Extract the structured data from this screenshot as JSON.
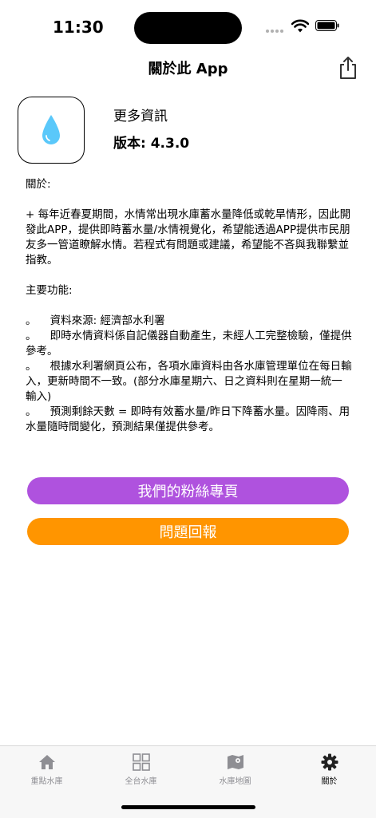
{
  "status": {
    "time": "11:30"
  },
  "nav": {
    "title": "關於此 App",
    "share_icon": "share-icon"
  },
  "app": {
    "icon": "water-drop-icon",
    "more_info": "更多資訊",
    "version": "版本: 4.3.0"
  },
  "about": {
    "text": "關於:\n\n+ 每年近春夏期間，水情常出現水庫蓄水量降低或乾旱情形，因此開發此APP，提供即時蓄水量/水情視覺化，希望能透過APP提供市民朋友多一管道瞭解水情。若程式有問題或建議，希望能不吝與我聯繫並指教。\n\n主要功能:\n\n。    資料來源: 經濟部水利署\n。    即時水情資料係自記儀器自動產生，未經人工完整檢驗，僅提供參考。\n。    根據水利署網頁公布，各項水庫資料由各水庫管理單位在每日輸入，更新時間不一致。(部分水庫星期六、日之資料則在星期一統一輸入)\n。    預測剩餘天數 = 即時有效蓄水量/昨日下降蓄水量。因降雨、用水量隨時間變化，預測結果僅提供參考。"
  },
  "buttons": {
    "fans": "我們的粉絲專頁",
    "feedback": "問題回報"
  },
  "colors": {
    "fans": "#af52de",
    "feedback": "#ff9500",
    "drop": "#5ac8fa"
  },
  "tabs": [
    {
      "label": "重點水庫",
      "icon": "home-icon"
    },
    {
      "label": "全台水庫",
      "icon": "grid-icon"
    },
    {
      "label": "水庫地圖",
      "icon": "map-icon"
    },
    {
      "label": "關於",
      "icon": "gear-icon",
      "active": true
    }
  ]
}
